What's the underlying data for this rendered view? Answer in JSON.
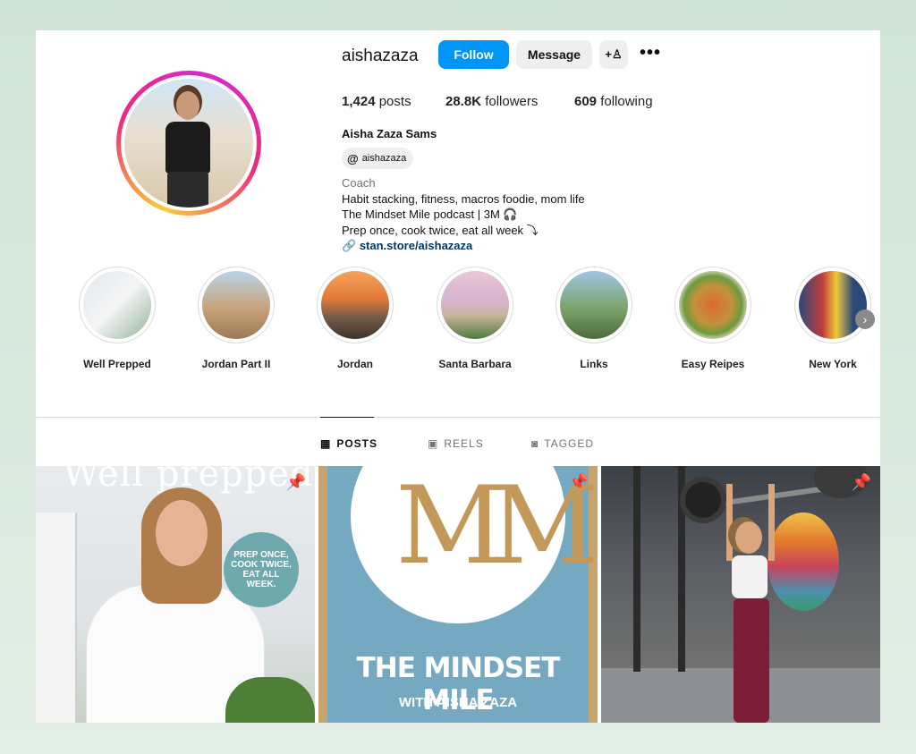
{
  "profile": {
    "username": "aishazaza",
    "follow_label": "Follow",
    "message_label": "Message",
    "add_user_icon": "+♙",
    "more_icon": "•••",
    "posts_count": "1,424",
    "posts_label": "posts",
    "followers_count": "28.8K",
    "followers_label": "followers",
    "following_count": "609",
    "following_label": "following",
    "full_name": "Aisha Zaza Sams",
    "threads_handle": "aishazaza",
    "category": "Coach",
    "bio_lines": [
      "Habit stacking, fitness, macros foodie, mom life",
      "The Mindset Mile podcast | 3M 🎧",
      "Prep once, cook twice, eat all week ⤵"
    ],
    "link": "stan.store/aishazaza",
    "accent_color": "#0095f6"
  },
  "highlights": [
    {
      "label": "Well Prepped"
    },
    {
      "label": "Jordan Part II"
    },
    {
      "label": "Jordan"
    },
    {
      "label": "Santa Barbara"
    },
    {
      "label": "Links"
    },
    {
      "label": "Easy Reipes"
    },
    {
      "label": "New York"
    }
  ],
  "tabs": [
    {
      "label": "POSTS",
      "icon": "grid-icon",
      "active": true
    },
    {
      "label": "REELS",
      "icon": "reels-icon",
      "active": false
    },
    {
      "label": "TAGGED",
      "icon": "tagged-icon",
      "active": false
    }
  ],
  "posts": [
    {
      "title_text": "Well prepped",
      "badge_text": "PREP ONCE, COOK TWICE, EAT ALL WEEK.",
      "pinned": true
    },
    {
      "logo_text": "MM",
      "title_text": "THE MINDSET MILE",
      "subtitle_text": "WITH AISHA ZAZA",
      "pinned": true
    },
    {
      "pinned": true
    }
  ]
}
